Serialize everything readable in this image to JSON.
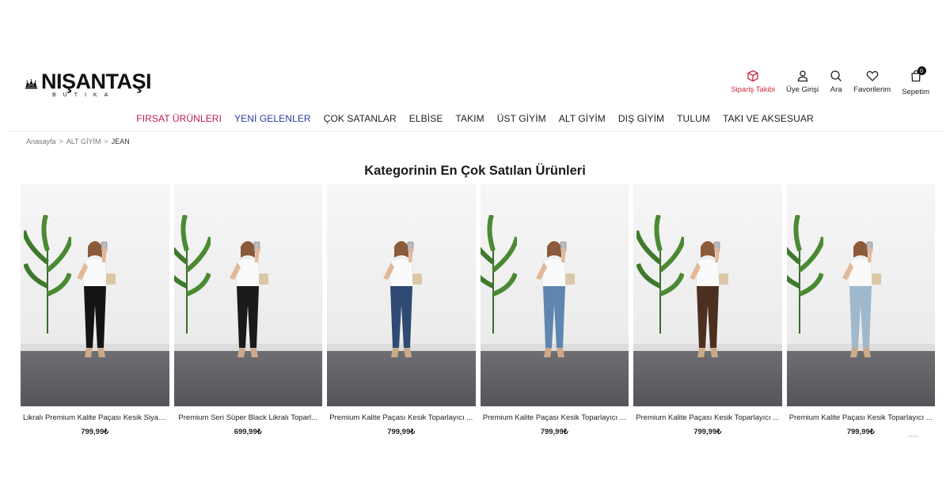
{
  "header": {
    "logo_text": "NIŞANTAŞI",
    "logo_sub": "BUTIKA",
    "actions": [
      {
        "label": "Sipariş Takibi",
        "icon": "package-icon",
        "color": "#d12a3d"
      },
      {
        "label": "Üye Girişi",
        "icon": "user-icon"
      },
      {
        "label": "Ara",
        "icon": "search-icon"
      },
      {
        "label": "Favorilerim",
        "icon": "heart-icon"
      },
      {
        "label": "Sepetim",
        "icon": "bag-icon",
        "badge": "0"
      }
    ]
  },
  "nav": {
    "items": [
      {
        "label": "FIRSAT ÜRÜNLERI",
        "color": "#c2185b"
      },
      {
        "label": "YENİ GELENLER",
        "color": "#2b3aa0"
      },
      {
        "label": "ÇOK SATANLAR"
      },
      {
        "label": "ELBİSE"
      },
      {
        "label": "TAKIM"
      },
      {
        "label": "ÜST GİYİM"
      },
      {
        "label": "ALT GİYİM"
      },
      {
        "label": "DIŞ GİYİM"
      },
      {
        "label": "TULUM"
      },
      {
        "label": "TAKI VE AKSESUAR"
      }
    ]
  },
  "breadcrumb": {
    "items": [
      "Anasayfa",
      "ALT GİYİM",
      "JEAN"
    ],
    "separator": ">"
  },
  "section": {
    "title": "Kategorinin En Çok Satılan Ürünleri"
  },
  "products": [
    {
      "name": "Likralı Premium Kalite Paçası Kesik Siyah...",
      "price": "799,99₺",
      "top": "white",
      "jeans": "#141414"
    },
    {
      "name": "Premium Seri Süper Black Likralı Toparl...",
      "price": "699,99₺",
      "top": "white",
      "jeans": "#1a1a1a"
    },
    {
      "name": "Premium Kalite Paçası Kesik Toparlayıcı ...",
      "price": "799,99₺",
      "top": "white",
      "jeans": "#2f4a73"
    },
    {
      "name": "Premium Kalite Paçası Kesik Toparlayıcı ...",
      "price": "799,99₺",
      "top": "white",
      "jeans": "#5f86b0"
    },
    {
      "name": "Premium Kalite Paçası Kesik Toparlayıcı ...",
      "price": "799,99₺",
      "top": "white",
      "jeans": "#4b3020"
    },
    {
      "name": "Premium Kalite Paçası Kesik Toparlayıcı ...",
      "price": "799,99₺",
      "top": "white",
      "jeans": "#9fb8cc"
    }
  ]
}
